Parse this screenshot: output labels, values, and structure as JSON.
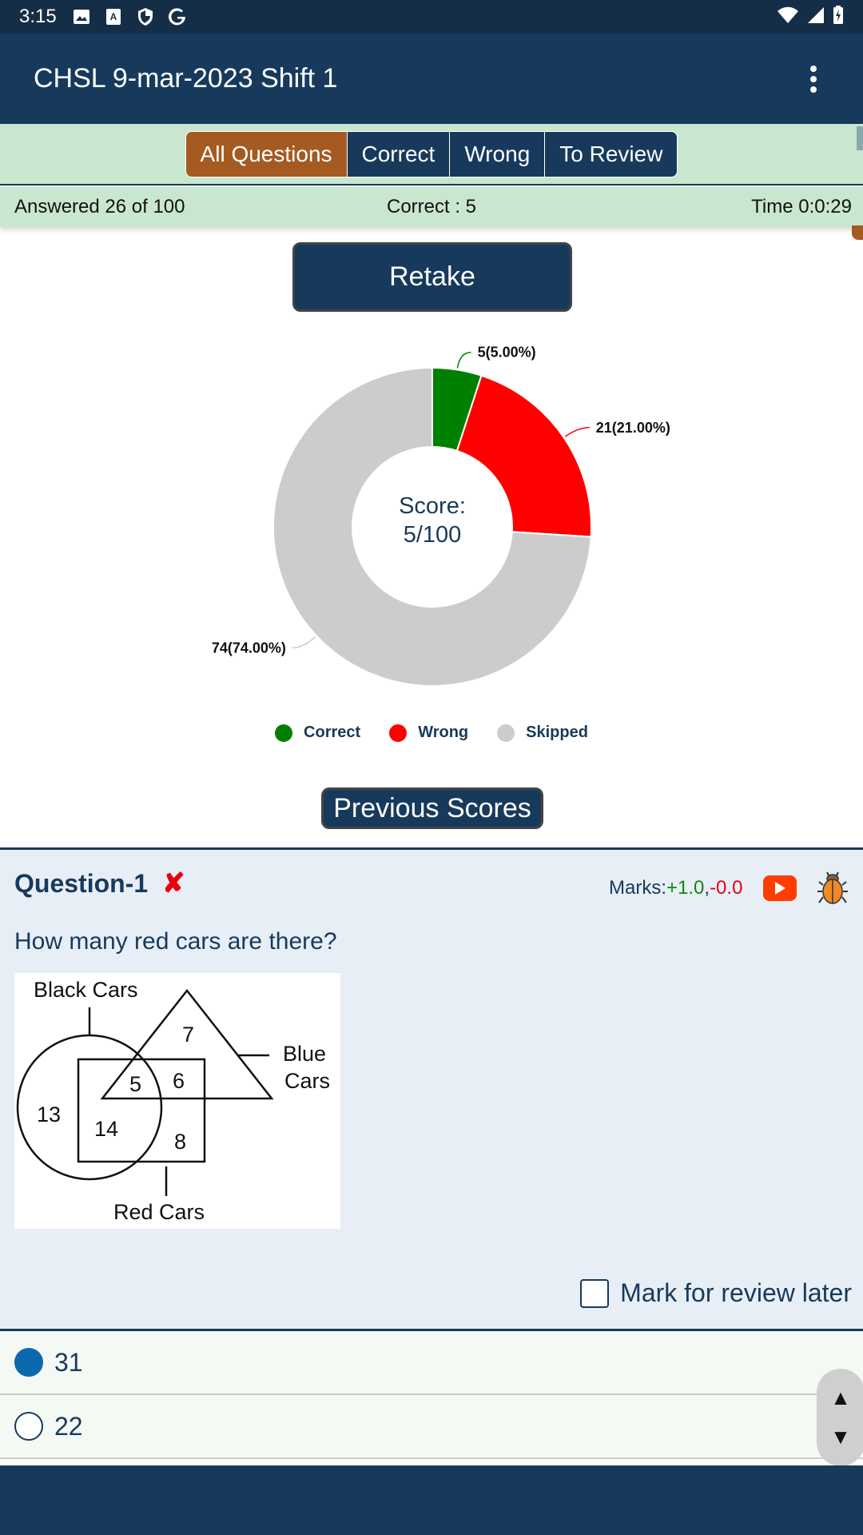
{
  "status_bar": {
    "time": "3:15",
    "left_icons": [
      "image-icon",
      "font-a-icon",
      "shield-icon",
      "google-g-icon"
    ],
    "right_icons": [
      "wifi-icon",
      "signal-icon",
      "battery-charging-icon"
    ]
  },
  "app_bar": {
    "title": "CHSL 9-mar-2023 Shift 1",
    "menu_icon": "more-vert-icon"
  },
  "filter_tabs": [
    {
      "label": "All Questions",
      "active": true
    },
    {
      "label": "Correct",
      "active": false
    },
    {
      "label": "Wrong",
      "active": false
    },
    {
      "label": "To Review",
      "active": false
    }
  ],
  "stats": {
    "answered": "Answered 26 of 100",
    "correct": "Correct : 5",
    "time": "Time 0:0:29"
  },
  "buttons": {
    "retake": "Retake",
    "previous_scores": "Previous Scores"
  },
  "chart_data": {
    "type": "pie",
    "donut": true,
    "center_label_line1": "Score:",
    "center_label_line2": "5/100",
    "slices": [
      {
        "name": "Correct",
        "value": 5,
        "percent": 5.0,
        "label": "5(5.00%)",
        "color": "#008000"
      },
      {
        "name": "Wrong",
        "value": 21,
        "percent": 21.0,
        "label": "21(21.00%)",
        "color": "#ff0000"
      },
      {
        "name": "Skipped",
        "value": 74,
        "percent": 74.0,
        "label": "74(74.00%)",
        "color": "#cccccc"
      }
    ],
    "legend": [
      "Correct",
      "Wrong",
      "Skipped"
    ],
    "legend_position": "bottom"
  },
  "question": {
    "title": "Question-1",
    "status_icon": "wrong-cross-icon",
    "status_symbol": "✘",
    "marks_label": "Marks:",
    "marks_positive": "+1.0",
    "marks_separator": ",",
    "marks_negative": "-0.0",
    "text": "How many red cars are there?",
    "image": {
      "labels": {
        "black": "Black Cars",
        "blue1": "Blue",
        "blue2": "Cars",
        "red": "Red Cars"
      },
      "numbers": [
        "7",
        "5",
        "6",
        "13",
        "14",
        "8"
      ]
    },
    "review_label": "Mark for review later",
    "review_checked": false
  },
  "options": [
    {
      "label": "31",
      "selected": true
    },
    {
      "label": "22",
      "selected": false
    }
  ],
  "scroll_nav": {
    "up": "▲",
    "down": "▼"
  },
  "colors": {
    "primary": "#173a5c",
    "active_tab": "#a55a22",
    "stat_bg": "#c9e7cf",
    "correct": "#008000",
    "wrong": "#ff0000",
    "skipped": "#cccccc"
  }
}
